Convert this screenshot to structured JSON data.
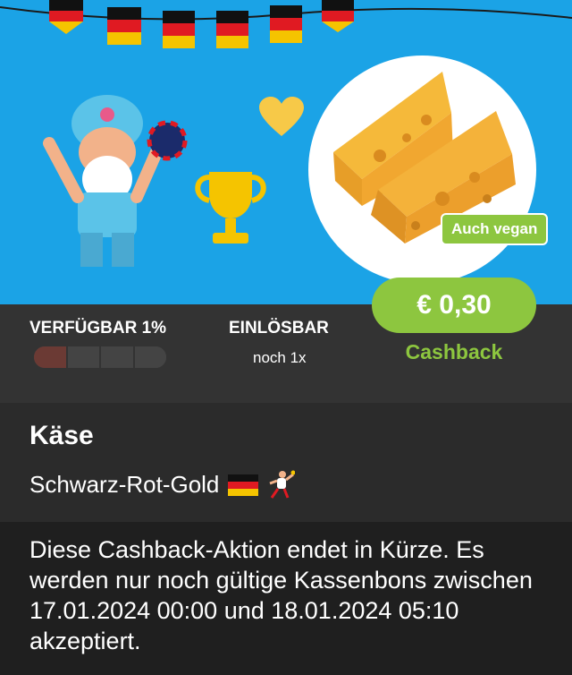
{
  "hero": {
    "badge_label": "Auch vegan"
  },
  "stats": {
    "available_label": "VERFÜGBAR 1%",
    "available_fraction": 0.01,
    "redeemable_label": "EINLÖSBAR",
    "redeemable_value": "noch 1x"
  },
  "cashback": {
    "amount": "€ 0,30",
    "label": "Cashback"
  },
  "product": {
    "name": "Käse",
    "tag": "Schwarz-Rot-Gold"
  },
  "notice": {
    "text": "Diese Cashback-Aktion endet in Kürze. Es werden nur noch gültige Kassenbons zwischen 17.01.2024 00:00 und 18.01.2024 05:10 akzeptiert."
  },
  "colors": {
    "hero_bg": "#1ba3e6",
    "accent_green": "#8dc63f",
    "dark_bg": "#333333",
    "notice_bg": "#1f1f1f"
  },
  "icons": [
    "flag-garland",
    "mascot-illustration",
    "heart-icon",
    "trophy-icon",
    "cheese-image",
    "germany-flag-emoji",
    "handball-player-emoji"
  ]
}
